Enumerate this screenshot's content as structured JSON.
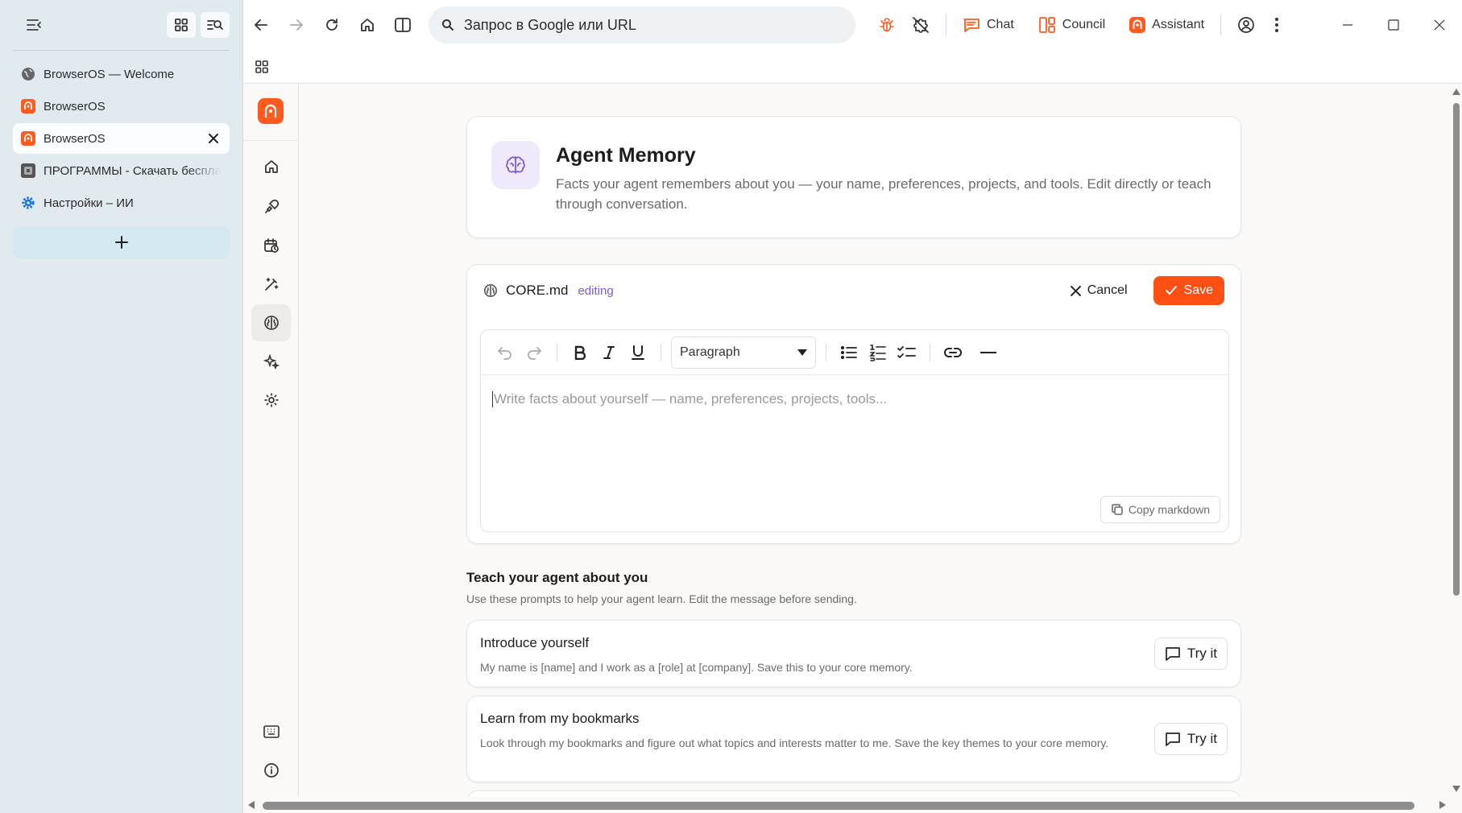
{
  "tabs": [
    {
      "title": "BrowserOS — Welcome",
      "icon": "globe-icon",
      "active": false
    },
    {
      "title": "BrowserOS",
      "icon": "browseros-icon",
      "active": false
    },
    {
      "title": "BrowserOS",
      "icon": "browseros-icon",
      "active": true
    },
    {
      "title": "ПРОГРАММЫ - Скачать бесплатно",
      "icon": "site-icon",
      "active": false
    },
    {
      "title": "Настройки – ИИ",
      "icon": "settings-gear-icon",
      "active": false
    }
  ],
  "omnibox": {
    "placeholder": "Запрос в Google или URL"
  },
  "toolbar": {
    "chat": "Chat",
    "council": "Council",
    "assistant": "Assistant"
  },
  "colors": {
    "accent": "#ff4f12",
    "brand": "#ff5a1f",
    "editing": "#7b5bd6",
    "hero_icon_bg": "#efe9fb"
  },
  "hero": {
    "title": "Agent Memory",
    "description": "Facts your agent remembers about you — your name, preferences, projects, and tools. Edit directly or teach through conversation."
  },
  "editor": {
    "file_name": "CORE.md",
    "status": "editing",
    "cancel_label": "Cancel",
    "save_label": "Save",
    "block_type": "Paragraph",
    "placeholder": "Write facts about yourself — name, preferences, projects, tools...",
    "copy_label": "Copy markdown"
  },
  "teach": {
    "title": "Teach your agent about you",
    "subtitle": "Use these prompts to help your agent learn. Edit the message before sending.",
    "prompts": [
      {
        "title": "Introduce yourself",
        "text": "My name is [name] and I work as a [role] at [company]. Save this to your core memory.",
        "button": "Try it"
      },
      {
        "title": "Learn from my bookmarks",
        "text": "Look through my bookmarks and figure out what topics and interests matter to me. Save the key themes to your core memory.",
        "button": "Try it"
      }
    ]
  }
}
